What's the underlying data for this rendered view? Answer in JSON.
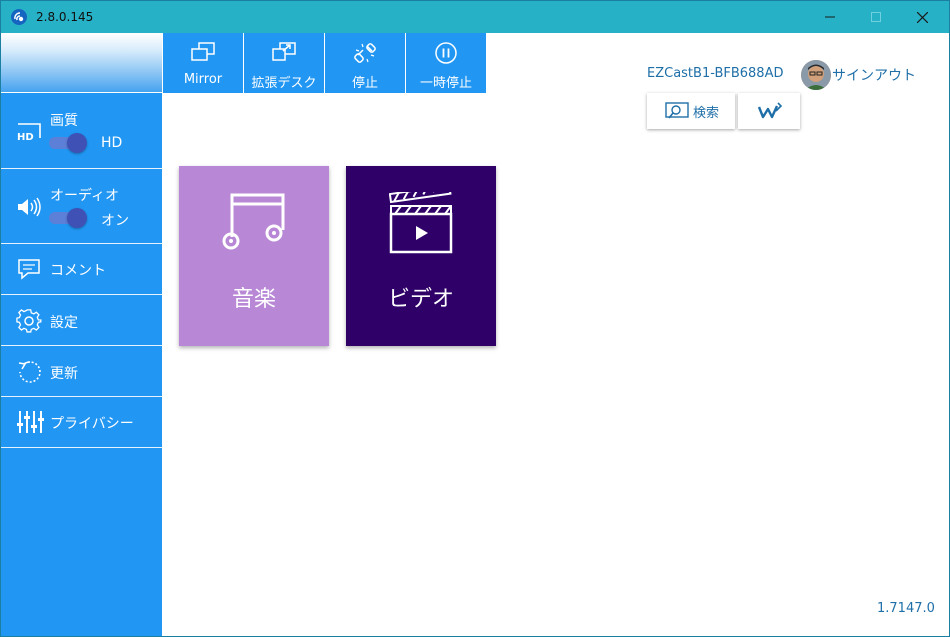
{
  "window": {
    "title": "2.8.0.145",
    "controls": [
      "minimize",
      "maximize",
      "close"
    ]
  },
  "sidebar": {
    "quality": {
      "label": "画質",
      "value": "HD",
      "icon": "hd-icon"
    },
    "audio": {
      "label": "オーディオ",
      "value": "オン",
      "icon": "speaker-icon"
    },
    "items": [
      {
        "label": "コメント",
        "icon": "comment-icon"
      },
      {
        "label": "設定",
        "icon": "gear-icon"
      },
      {
        "label": "更新",
        "icon": "refresh-icon"
      },
      {
        "label": "プライバシー",
        "icon": "sliders-icon"
      }
    ]
  },
  "toolbar": {
    "buttons": [
      {
        "label": "Mirror",
        "icon": "mirror-icon"
      },
      {
        "label": "拡張デスク",
        "icon": "extend-icon"
      },
      {
        "label": "停止",
        "icon": "disconnect-icon"
      },
      {
        "label": "一時停止",
        "icon": "pause-icon"
      }
    ]
  },
  "header": {
    "device_name": "EZCastB1-BFB688AD",
    "signout_label": "サインアウト",
    "search_label": "検索"
  },
  "tiles": [
    {
      "label": "音楽",
      "icon": "music-note-icon",
      "color": "#b887d6"
    },
    {
      "label": "ビデオ",
      "icon": "clapperboard-icon",
      "color": "#2e0068"
    }
  ],
  "footer": {
    "version": "1.7147.0"
  },
  "colors": {
    "titlebar": "#27b1c7",
    "sidebar": "#2196f3",
    "text_blue": "#1e6fa8",
    "toggle_knob": "#3f51b5"
  }
}
